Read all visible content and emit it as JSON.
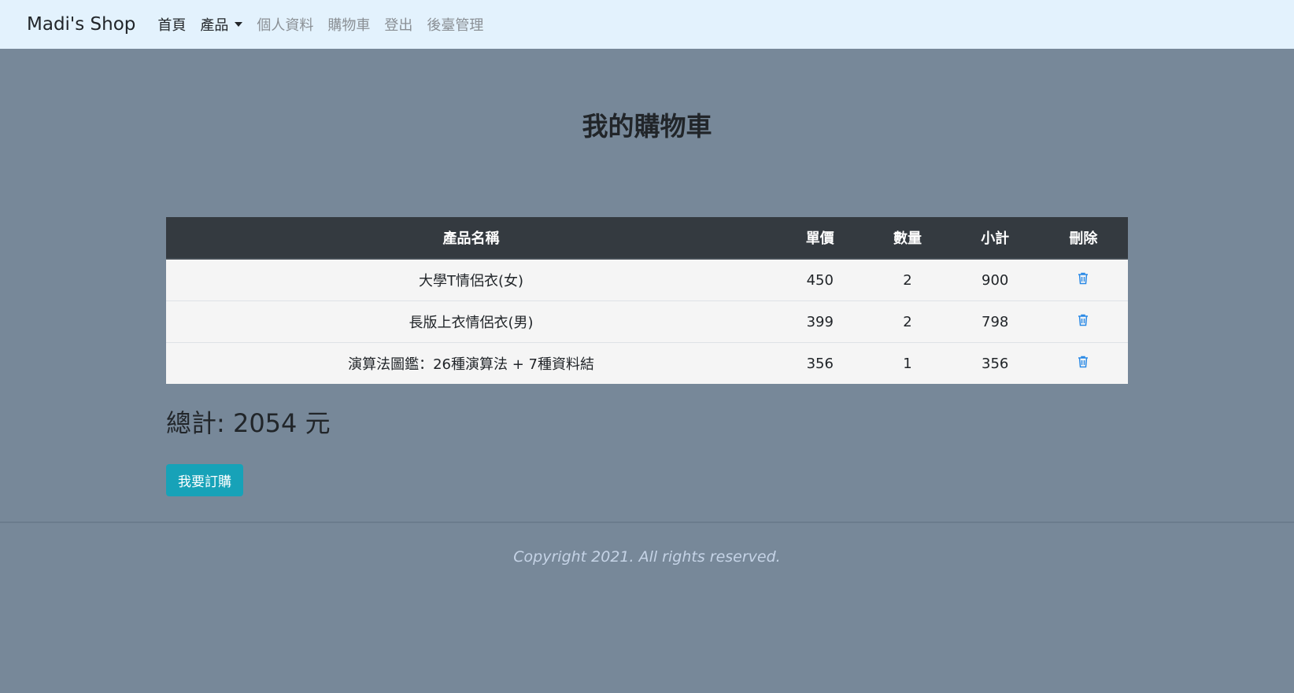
{
  "navbar": {
    "brand": "Madi's Shop",
    "links": [
      {
        "label": "首頁"
      },
      {
        "label": "產品"
      },
      {
        "label": "個人資料"
      },
      {
        "label": "購物車"
      },
      {
        "label": "登出"
      },
      {
        "label": "後臺管理"
      }
    ]
  },
  "page": {
    "title": "我的購物車"
  },
  "table": {
    "headers": {
      "name": "產品名稱",
      "price": "單價",
      "qty": "數量",
      "subtotal": "小計",
      "delete": "刪除"
    },
    "rows": [
      {
        "name": "大學T情侶衣(女)",
        "price": "450",
        "qty": "2",
        "subtotal": "900"
      },
      {
        "name": "長版上衣情侶衣(男)",
        "price": "399",
        "qty": "2",
        "subtotal": "798"
      },
      {
        "name": "演算法圖鑑：26種演算法 + 7種資料結",
        "price": "356",
        "qty": "1",
        "subtotal": "356"
      }
    ]
  },
  "summary": {
    "total_text": "總計: 2054 元"
  },
  "actions": {
    "order_label": "我要訂購"
  },
  "footer": {
    "copyright": "Copyright 2021. All rights reserved."
  },
  "colors": {
    "background": "#778899",
    "navbar": "#e3f2fd",
    "table_header": "#343a40",
    "button": "#17a2b8",
    "trash_icon": "#2b8ae6"
  },
  "icons": {
    "delete": "trash-icon"
  }
}
